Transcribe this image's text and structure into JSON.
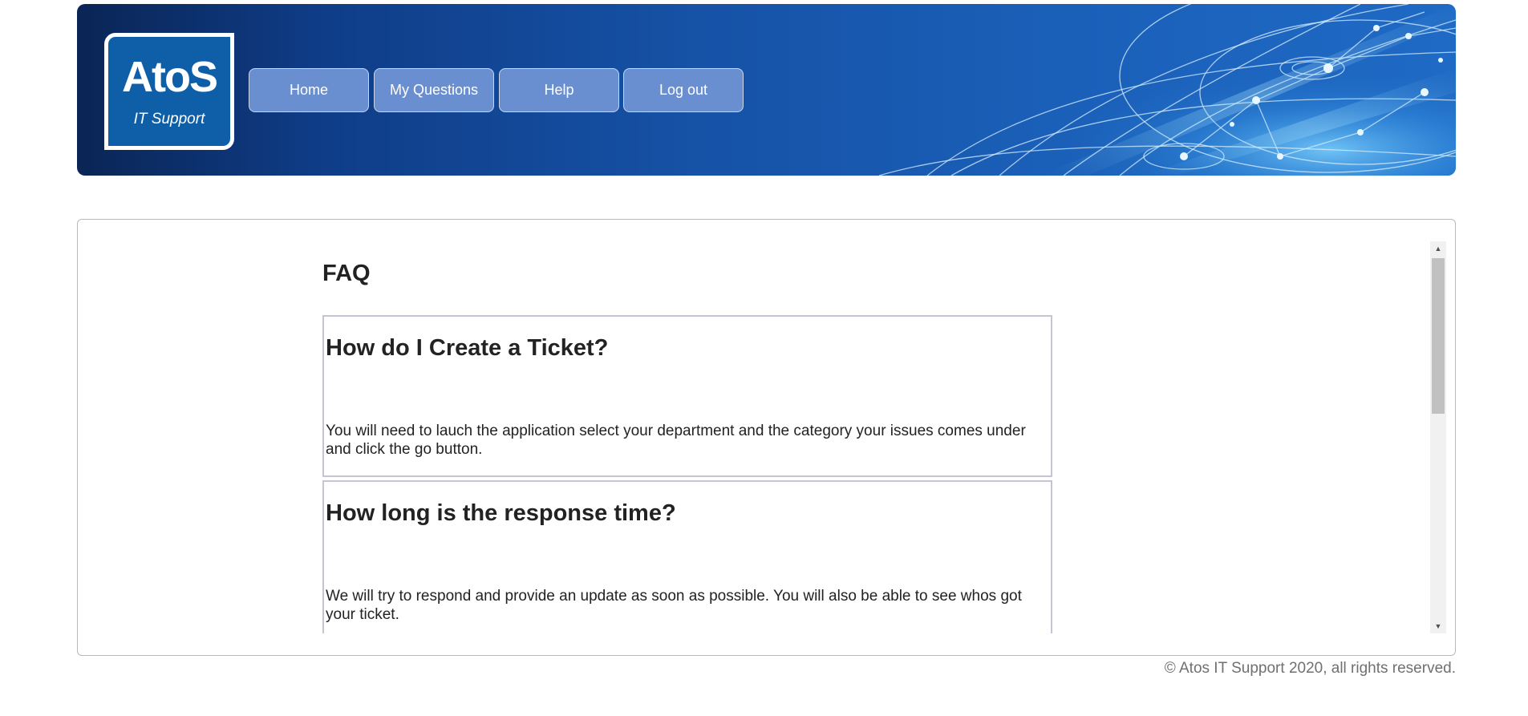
{
  "header": {
    "logo": {
      "word": "AtoS",
      "subtitle": "IT Support"
    },
    "nav": [
      {
        "label": "Home"
      },
      {
        "label": "My Questions"
      },
      {
        "label": "Help"
      },
      {
        "label": "Log out"
      }
    ]
  },
  "main": {
    "title": "FAQ",
    "faqs": [
      {
        "question": "How do I Create a Ticket?",
        "answer": "You will need to lauch the application select your department and the category your issues comes under and click the go button."
      },
      {
        "question": "How long is the response time?",
        "answer": "We will try to respond and provide an update as soon as possible. You will also be able to see whos got your ticket."
      }
    ],
    "scrollbar": {
      "up_icon": "triangle-up",
      "down_icon": "triangle-down"
    }
  },
  "footer": {
    "copyright": "© Atos IT Support 2020, all rights reserved."
  },
  "colors": {
    "banner_dark": "#0a2555",
    "banner_light": "#1f6ac5",
    "nav_button": "#6a8fd0",
    "text": "#222222",
    "footer_text": "#707070"
  }
}
